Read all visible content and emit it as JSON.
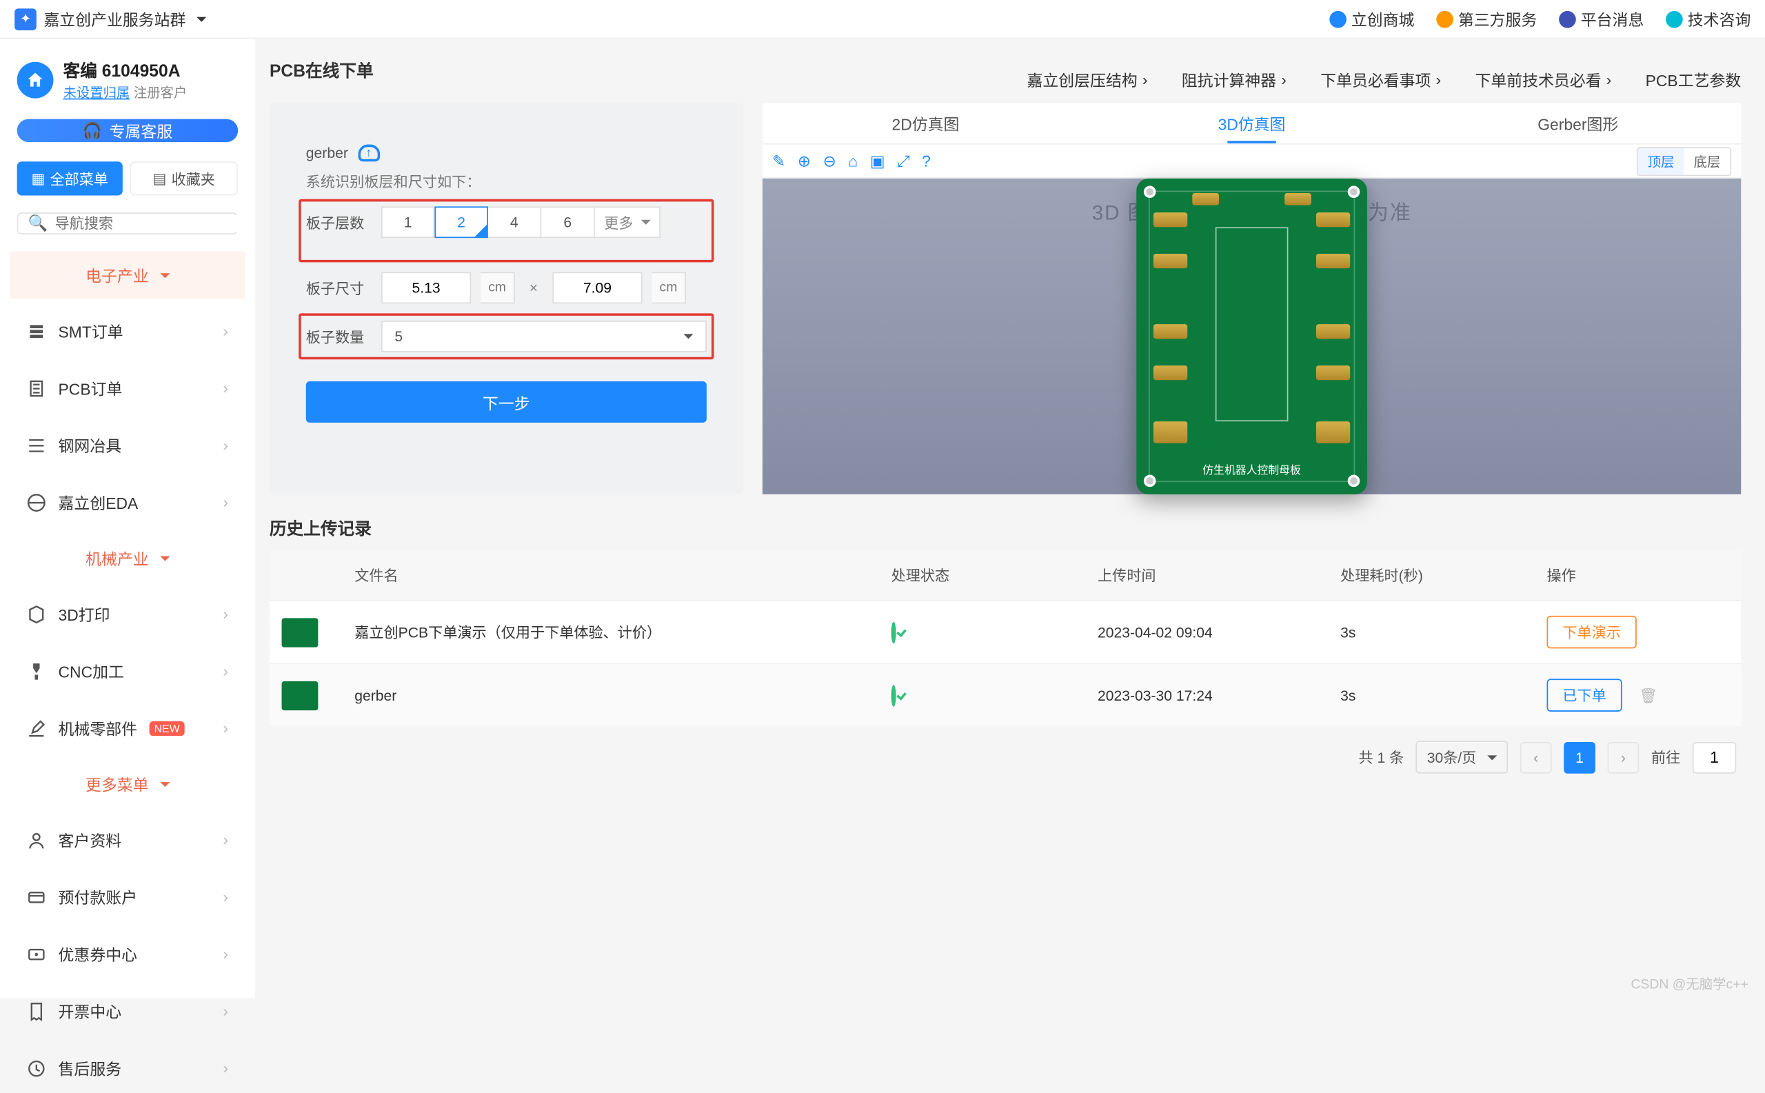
{
  "header": {
    "brand": "嘉立创产业服务站群",
    "links": [
      {
        "label": "立创商城",
        "color": "d-blue"
      },
      {
        "label": "第三方服务",
        "color": "d-orange"
      },
      {
        "label": "平台消息",
        "color": "d-indigo"
      },
      {
        "label": "技术咨询",
        "color": "d-cyan"
      }
    ]
  },
  "customer": {
    "title": "客编 6104950A",
    "unset": "未设置归属",
    "tag": "注册客户",
    "vip_btn": "专属客服"
  },
  "menu_mode": {
    "all": "全部菜单",
    "fav": "收藏夹"
  },
  "search_placeholder": "导航搜索",
  "cats": {
    "elec": "电子产业",
    "mech": "机械产业",
    "more": "更多菜单"
  },
  "nav": {
    "smt": "SMT订单",
    "pcb": "PCB订单",
    "stencil": "钢网冶具",
    "eda": "嘉立创EDA",
    "print3d": "3D打印",
    "cnc": "CNC加工",
    "parts": "机械零部件",
    "profile": "客户资料",
    "prepay": "预付款账户",
    "coupon": "优惠券中心",
    "invoice": "开票中心",
    "after": "售后服务"
  },
  "page": {
    "title": "PCB在线下单",
    "quicklinks": [
      "嘉立创层压结构",
      "阻抗计算神器",
      "下单员必看事项",
      "下单前技术员必看",
      "PCB工艺参数"
    ]
  },
  "form": {
    "file_name": "gerber",
    "hint": "系统识别板层和尺寸如下：",
    "layers_label": "板子层数",
    "layers": [
      "1",
      "2",
      "4",
      "6"
    ],
    "layers_more": "更多",
    "selected_layer": "2",
    "size_label": "板子尺寸",
    "w": "5.13",
    "h": "7.09",
    "unit": "cm",
    "qty_label": "板子数量",
    "qty": "5",
    "next": "下一步"
  },
  "preview": {
    "tabs": [
      "2D仿真图",
      "3D仿真图",
      "Gerber图形"
    ],
    "active_tab": 1,
    "layer_top": "顶层",
    "layer_bot": "底层",
    "note": "3D 图仅供参考，具体以实物为准",
    "silk": "仿生机器人控制母板"
  },
  "history": {
    "title": "历史上传记录",
    "cols": [
      "文件名",
      "处理状态",
      "上传时间",
      "处理耗时(秒)",
      "操作"
    ],
    "rows": [
      {
        "name": "嘉立创PCB下单演示（仅用于下单体验、计价）",
        "time": "2023-04-02 09:04",
        "dur": "3s",
        "action": "下单演示",
        "style": "b-orange",
        "trash": false
      },
      {
        "name": "gerber",
        "time": "2023-03-30 17:24",
        "dur": "3s",
        "action": "已下单",
        "style": "b-blue",
        "trash": true
      }
    ]
  },
  "pager": {
    "total_label": "共 1 条",
    "size": "30条/页",
    "cur": "1",
    "goto": "前往",
    "page": "1"
  },
  "watermark": "CSDN @无脑学c++"
}
